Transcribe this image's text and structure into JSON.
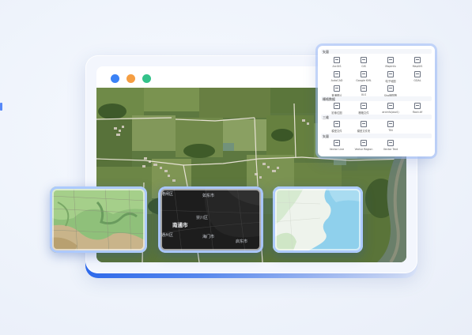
{
  "window": {
    "traffic_lights": [
      {
        "name": "blue",
        "color": "#3b82f6"
      },
      {
        "name": "orange",
        "color": "#f59e42"
      },
      {
        "name": "green",
        "color": "#34c28a"
      }
    ]
  },
  "thumbnails": {
    "dark_map": {
      "labels": [
        "南通市",
        "崇川区",
        "港闸区",
        "通州区",
        "海门市",
        "启东市",
        "如东市"
      ]
    }
  },
  "layer_panel": {
    "sections": [
      {
        "title": "矢量",
        "items": [
          "ArcGIS",
          "GIS",
          "MapInfo",
          "MapGIS",
          "AutoCAD",
          "Google KML",
          "电子地图",
          "GDAL",
          "普通图片",
          "XLS",
          "Shp缩图等"
        ]
      },
      {
        "title": "栅格数据",
        "items": [
          "影像位图",
          "栅格文件",
          "arcinfo(ascii)",
          "flash.tif"
        ]
      },
      {
        "title": "三维",
        "items": [
          "模型文件",
          "模型文件夹",
          "TIN"
        ]
      },
      {
        "title": "矢量",
        "items": [
          "Vector Line",
          "Vector Region",
          "Vector Text"
        ]
      }
    ]
  }
}
